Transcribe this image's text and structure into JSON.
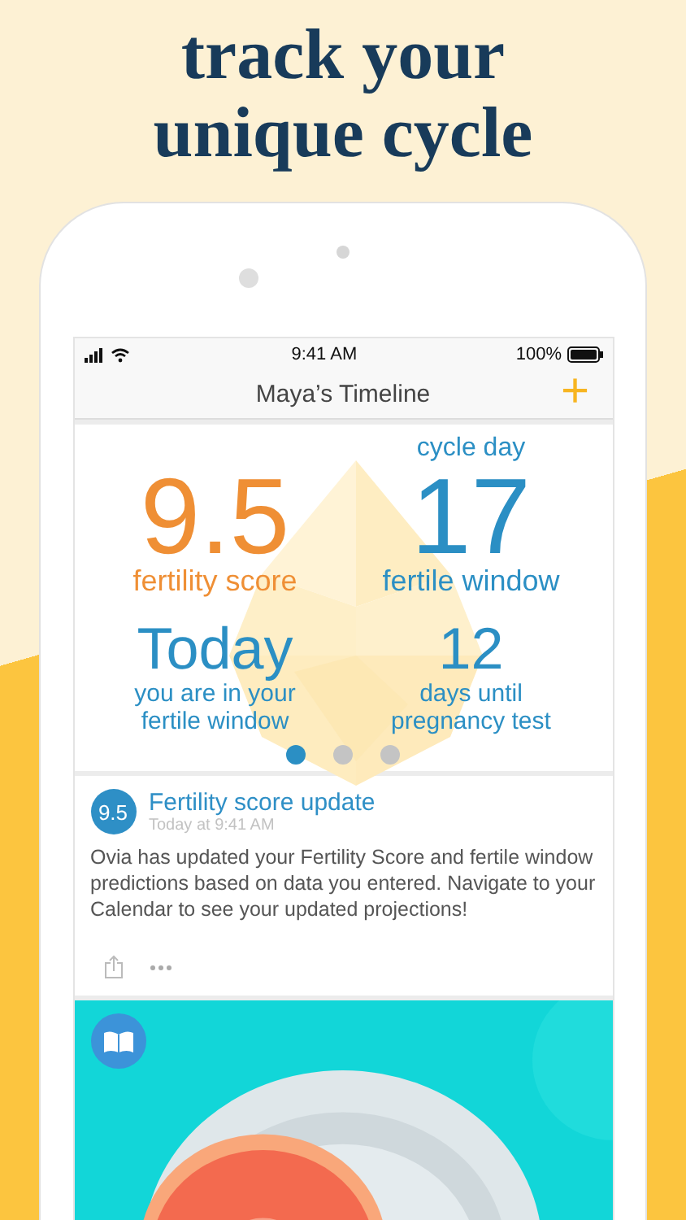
{
  "headline": "track your unique cycle",
  "status_bar": {
    "time": "9:41 AM",
    "battery": "100%"
  },
  "nav_bar": {
    "title": "Maya’s Timeline",
    "action": "+"
  },
  "cycle_caption": "cycle day",
  "stats": [
    {
      "kind": "big",
      "value": "9.5",
      "label": "fertility score",
      "color": "#ef8f35"
    },
    {
      "kind": "big",
      "value": "17",
      "label": "fertile window",
      "color": "#2b8fc4"
    },
    {
      "kind": "small",
      "value": "Today",
      "label": "you are in your fertile window",
      "color": "#2b8fc4"
    },
    {
      "kind": "small",
      "value": "12",
      "label": "days until pregnancy test",
      "color": "#2b8fc4"
    }
  ],
  "pager": [
    {
      "selected": true
    },
    {
      "selected": false
    },
    {
      "selected": false
    }
  ],
  "post": {
    "badge": "9.5",
    "title": "Fertility score update",
    "time": "Today at 9:41 AM",
    "body": "Ovia has updated your Fertility Score and fertile window predictions based on data you entered. Navigate to your Calendar to see your updated projections!"
  }
}
